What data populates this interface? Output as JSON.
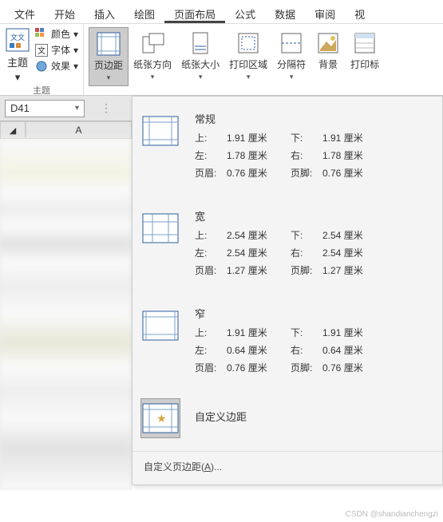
{
  "menubar": [
    "文件",
    "开始",
    "插入",
    "绘图",
    "页面布局",
    "公式",
    "数据",
    "审阅",
    "视"
  ],
  "menubar_active_index": 4,
  "ribbon": {
    "theme_group": {
      "label": "主题",
      "theme_btn": "主题",
      "color": "颜色",
      "font": "字体",
      "effect": "效果"
    },
    "buttons": {
      "margins": "页边距",
      "orientation": "纸张方向",
      "size": "纸张大小",
      "print_area": "打印区域",
      "breaks": "分隔符",
      "background": "背景",
      "print_titles": "打印标"
    }
  },
  "cell_ref": "D41",
  "col_header": "A",
  "dropdown": {
    "presets": [
      {
        "name": "常规",
        "rows": [
          {
            "l1": "上:",
            "v1": "1.91 厘米",
            "l2": "下:",
            "v2": "1.91 厘米"
          },
          {
            "l1": "左:",
            "v1": "1.78 厘米",
            "l2": "右:",
            "v2": "1.78 厘米"
          },
          {
            "l1": "页眉:",
            "v1": "0.76 厘米",
            "l2": "页脚:",
            "v2": "0.76 厘米"
          }
        ]
      },
      {
        "name": "宽",
        "rows": [
          {
            "l1": "上:",
            "v1": "2.54 厘米",
            "l2": "下:",
            "v2": "2.54 厘米"
          },
          {
            "l1": "左:",
            "v1": "2.54 厘米",
            "l2": "右:",
            "v2": "2.54 厘米"
          },
          {
            "l1": "页眉:",
            "v1": "1.27 厘米",
            "l2": "页脚:",
            "v2": "1.27 厘米"
          }
        ]
      },
      {
        "name": "窄",
        "rows": [
          {
            "l1": "上:",
            "v1": "1.91 厘米",
            "l2": "下:",
            "v2": "1.91 厘米"
          },
          {
            "l1": "左:",
            "v1": "0.64 厘米",
            "l2": "右:",
            "v2": "0.64 厘米"
          },
          {
            "l1": "页眉:",
            "v1": "0.76 厘米",
            "l2": "页脚:",
            "v2": "0.76 厘米"
          }
        ]
      }
    ],
    "custom_label": "自定义边距",
    "custom_footer": "自定义页边距(A)..."
  },
  "watermark": "CSDN @shandianchengzi"
}
